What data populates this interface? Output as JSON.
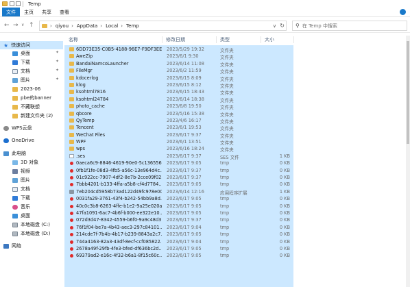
{
  "window": {
    "title": "Temp"
  },
  "ribbon": {
    "tabs": [
      "文件",
      "主页",
      "共享",
      "查看"
    ]
  },
  "address": {
    "crumbs": [
      "qiyou",
      "AppData",
      "Local",
      "Temp"
    ],
    "back_icon": "back-arrow-icon",
    "forward_icon": "forward-arrow-icon",
    "up_icon": "up-arrow-icon"
  },
  "search": {
    "placeholder": "在 Temp 中搜索"
  },
  "nav": {
    "items": [
      {
        "label": "快速访问",
        "icon": "star-icon",
        "selected": true
      },
      {
        "label": "桌面",
        "icon": "desktop-icon",
        "pinned": true
      },
      {
        "label": "下载",
        "icon": "download-icon",
        "pinned": true
      },
      {
        "label": "文档",
        "icon": "document-icon",
        "pinned": true
      },
      {
        "label": "图片",
        "icon": "picture-icon",
        "pinned": true
      },
      {
        "label": "2023-06",
        "icon": "folder-icon"
      },
      {
        "label": "pbe的banner",
        "icon": "folder-icon"
      },
      {
        "label": "不藏联想",
        "icon": "folder-icon"
      },
      {
        "label": "新建文件夹 (2)",
        "icon": "folder-icon"
      },
      {
        "label": "WPS云盘",
        "icon": "cloud-icon"
      },
      {
        "label": "OneDrive",
        "icon": "onedrive-icon"
      },
      {
        "label": "此电脑",
        "icon": "computer-icon"
      },
      {
        "label": "3D 对象",
        "icon": "3d-objects-icon"
      },
      {
        "label": "视频",
        "icon": "video-icon"
      },
      {
        "label": "图片",
        "icon": "picture-icon"
      },
      {
        "label": "文档",
        "icon": "document-icon"
      },
      {
        "label": "下载",
        "icon": "download-icon"
      },
      {
        "label": "音乐",
        "icon": "music-icon"
      },
      {
        "label": "桌面",
        "icon": "desktop-icon"
      },
      {
        "label": "本地磁盘 (C:)",
        "icon": "disk-icon"
      },
      {
        "label": "本地磁盘 (D:)",
        "icon": "disk-icon"
      },
      {
        "label": "网络",
        "icon": "network-icon"
      }
    ]
  },
  "columns": {
    "name": "名称",
    "date": "修改日期",
    "type": "类型",
    "size": "大小"
  },
  "files": [
    {
      "name": "6DD73E35-C0B5-4188-96E7-F9DF3EE...",
      "date": "2023/5/29 19:32",
      "type": "文件夹",
      "size": "",
      "kind": "folder"
    },
    {
      "name": "AweZip",
      "date": "2023/6/1 9:30",
      "type": "文件夹",
      "size": "",
      "kind": "folder"
    },
    {
      "name": "BandaiNamcoLauncher",
      "date": "2023/6/14 11:08",
      "type": "文件夹",
      "size": "",
      "kind": "folder"
    },
    {
      "name": "FileMgr",
      "date": "2023/6/2 11:59",
      "type": "文件夹",
      "size": "",
      "kind": "folder"
    },
    {
      "name": "kdocerlog",
      "date": "2023/6/15 8:09",
      "type": "文件夹",
      "size": "",
      "kind": "folder"
    },
    {
      "name": "klog",
      "date": "2023/6/15 8:12",
      "type": "文件夹",
      "size": "",
      "kind": "folder"
    },
    {
      "name": "ksohtml7816",
      "date": "2023/6/15 18:43",
      "type": "文件夹",
      "size": "",
      "kind": "folder"
    },
    {
      "name": "ksohtml24784",
      "date": "2023/6/14 18:38",
      "type": "文件夹",
      "size": "",
      "kind": "folder"
    },
    {
      "name": "photo_cache",
      "date": "2023/6/8 19:50",
      "type": "文件夹",
      "size": "",
      "kind": "folder"
    },
    {
      "name": "qbcore",
      "date": "2023/5/16 15:38",
      "type": "文件夹",
      "size": "",
      "kind": "folder"
    },
    {
      "name": "QyTemp",
      "date": "2023/4/6 16:17",
      "type": "文件夹",
      "size": "",
      "kind": "folder"
    },
    {
      "name": "Tencent",
      "date": "2023/6/1 19:53",
      "type": "文件夹",
      "size": "",
      "kind": "folder"
    },
    {
      "name": "WeChat Files",
      "date": "2023/6/17 9:37",
      "type": "文件夹",
      "size": "",
      "kind": "folder"
    },
    {
      "name": "WPF",
      "date": "2023/6/1 13:51",
      "type": "文件夹",
      "size": "",
      "kind": "folder"
    },
    {
      "name": "wps",
      "date": "2023/6/16 18:24",
      "type": "文件夹",
      "size": "",
      "kind": "folder"
    },
    {
      "name": ".ses",
      "date": "2023/6/17 9:37",
      "type": "SES 文件",
      "size": "1 KB",
      "kind": "file"
    },
    {
      "name": "0aeca6c9-8846-4619-90e0-5c136556f...",
      "date": "2023/6/17 9:05",
      "type": "tmp",
      "size": "0 KB",
      "kind": "tmp"
    },
    {
      "name": "0fb1f1fe-08d3-4fb5-a56c-13e964d4c...",
      "date": "2023/6/17 9:37",
      "type": "tmp",
      "size": "0 KB",
      "kind": "tmp"
    },
    {
      "name": "01c922cc-7907-4df2-8e7b-2cce09f02...",
      "date": "2023/6/17 9:37",
      "type": "tmp",
      "size": "0 KB",
      "kind": "tmp"
    },
    {
      "name": "7bbb4201-b133-4ffa-a5b8-cf4d7784...",
      "date": "2023/6/17 9:05",
      "type": "tmp",
      "size": "0 KB",
      "kind": "tmp"
    },
    {
      "name": "7eb204cd5958b73ad122d49fc978e00...",
      "date": "2023/6/14 12:16",
      "type": "应用程序扩展",
      "size": "1 KB",
      "kind": "app"
    },
    {
      "name": "0031fa29-3761-43f4-b242-54bb9a8d...",
      "date": "2023/6/17 9:05",
      "type": "tmp",
      "size": "0 KB",
      "kind": "tmp"
    },
    {
      "name": "40c0c3b8-6263-4ffe-b1e2-9a25e020a...",
      "date": "2023/6/17 9:05",
      "type": "tmp",
      "size": "0 KB",
      "kind": "tmp"
    },
    {
      "name": "47fa1091-6ac7-4b6f-b000-ee322e10...",
      "date": "2023/6/17 9:05",
      "type": "tmp",
      "size": "0 KB",
      "kind": "tmp"
    },
    {
      "name": "072d3d47-8342-4559-b6f0-9a9c48d3...",
      "date": "2023/6/17 9:37",
      "type": "tmp",
      "size": "0 KB",
      "kind": "tmp"
    },
    {
      "name": "76f1f04-be7a-4b43-aec3-297c84101...",
      "date": "2023/6/17 9:04",
      "type": "tmp",
      "size": "0 KB",
      "kind": "tmp"
    },
    {
      "name": "214cde7f-7b4b-4b17-b239-8843a2c7...",
      "date": "2023/6/17 9:05",
      "type": "tmp",
      "size": "0 KB",
      "kind": "tmp"
    },
    {
      "name": "744a4163-82a3-43df-8ecf-ccf085822...",
      "date": "2023/6/17 9:04",
      "type": "tmp",
      "size": "0 KB",
      "kind": "tmp"
    },
    {
      "name": "2678a49f-29fb-4fe3-bfed-df636bc2d...",
      "date": "2023/6/17 9:05",
      "type": "tmp",
      "size": "0 KB",
      "kind": "tmp"
    },
    {
      "name": "69379ad2-e16c-4f32-b6a1-8f15c60c...",
      "date": "2023/6/17 9:05",
      "type": "tmp",
      "size": "0 KB",
      "kind": "tmp"
    }
  ],
  "colors": {
    "selection": "#cce8ff",
    "accent": "#1979ca",
    "folder": "#e8b84a",
    "tmp_dot": "#e02a2a"
  }
}
